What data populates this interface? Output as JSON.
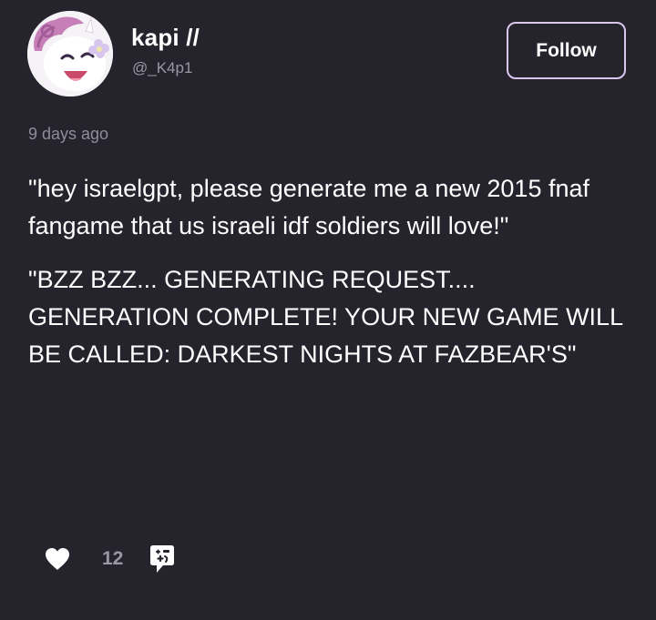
{
  "author": {
    "display_name": "kapi //",
    "handle": "@_K4p1",
    "avatar_icon": "pony-avatar"
  },
  "follow_button": {
    "label": "Follow",
    "border_color": "#d8c6ec"
  },
  "post": {
    "timestamp": "9 days ago",
    "paragraphs": [
      "\"hey israelgpt, please generate me a new 2015 fnaf fangame that us israeli idf soldiers will love!\"",
      "\"BZZ BZZ... GENERATING REQUEST.... GENERATION COMPLETE! YOUR NEW GAME WILL BE CALLED: DARKEST NIGHTS AT FAZBEAR'S\""
    ]
  },
  "actions": {
    "like_icon": "heart-icon",
    "like_count": "12",
    "reblog_icon": "reblog-icon"
  },
  "colors": {
    "background": "#25232c",
    "text": "#ffffff",
    "muted_text": "#9a98a2"
  }
}
